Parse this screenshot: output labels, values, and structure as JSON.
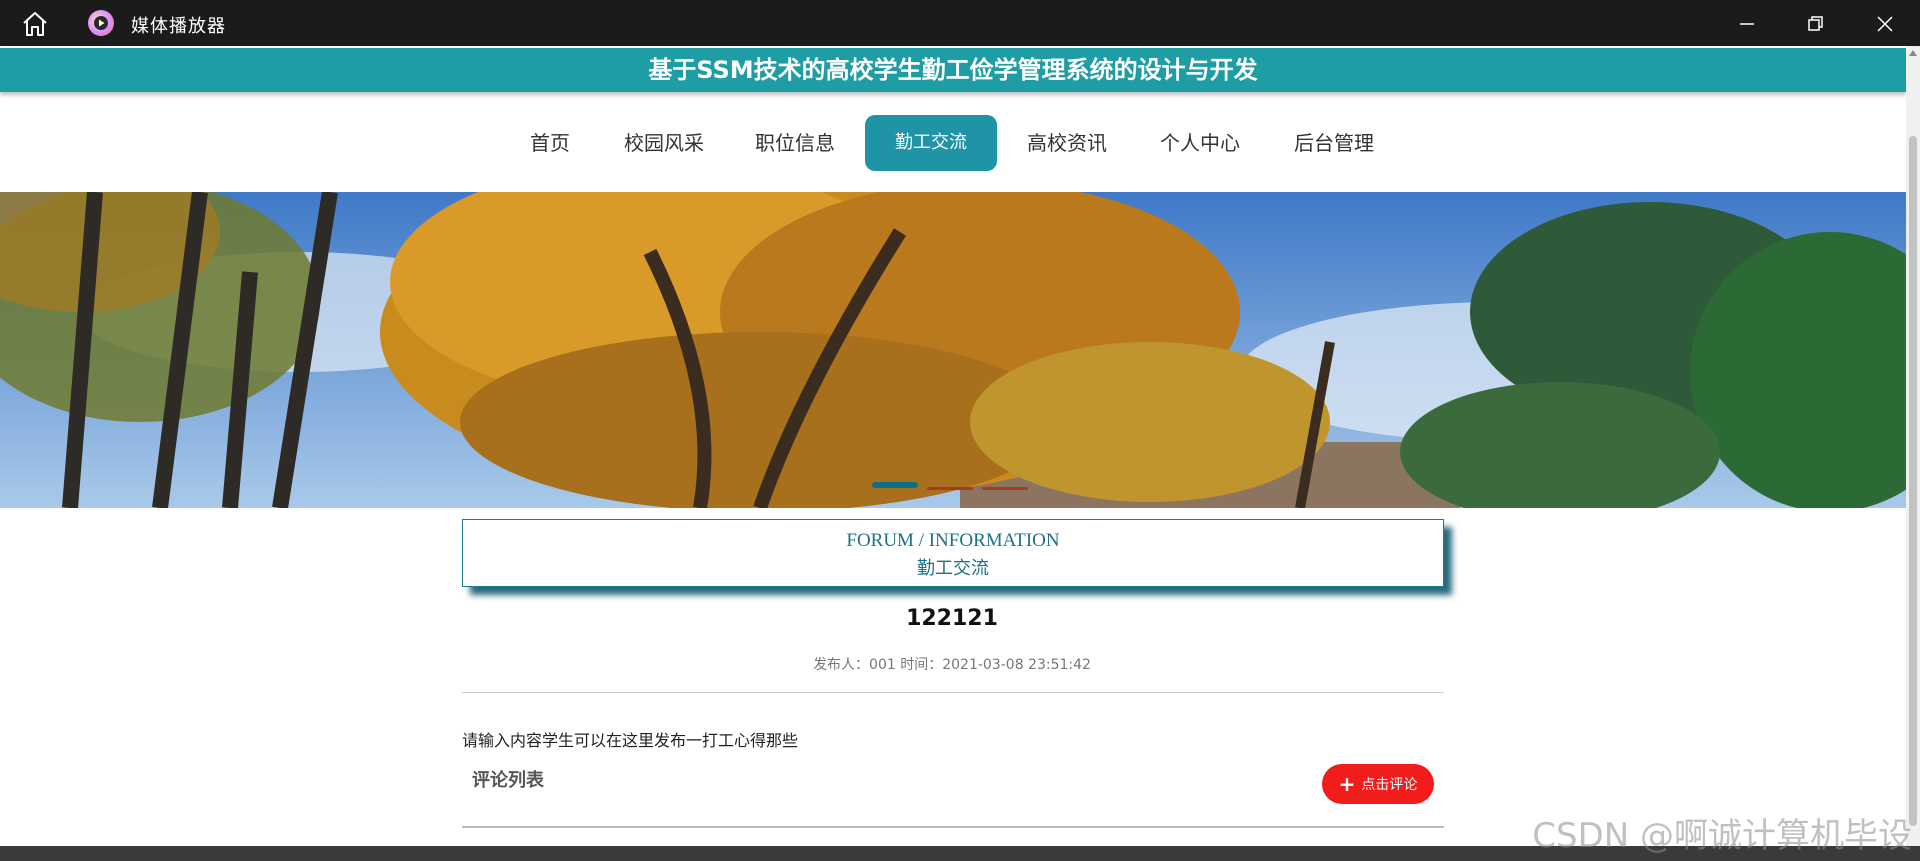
{
  "window": {
    "title": "媒体播放器"
  },
  "site": {
    "title": "基于SSM技术的高校学生勤工俭学管理系统的设计与开发"
  },
  "nav": [
    {
      "label": "首页"
    },
    {
      "label": "校园风采"
    },
    {
      "label": "职位信息"
    },
    {
      "label": "勤工交流",
      "active": true
    },
    {
      "label": "高校资讯"
    },
    {
      "label": "个人中心"
    },
    {
      "label": "后台管理"
    }
  ],
  "section": {
    "english": "FORUM / INFORMATION",
    "chinese": "勤工交流"
  },
  "post": {
    "title": "122121",
    "meta": "发布人：001 时间：2021-03-08 23:51:42",
    "content": "请输入内容学生可以在这里发布一打工心得那些"
  },
  "comments": {
    "heading": "评论列表",
    "button_label": "点击评论"
  },
  "colors": {
    "teal": "#1f9da5",
    "active_nav": "#1f94a6",
    "button_red": "#f11c1c"
  },
  "watermark": "CSDN @啊诚计算机毕设"
}
